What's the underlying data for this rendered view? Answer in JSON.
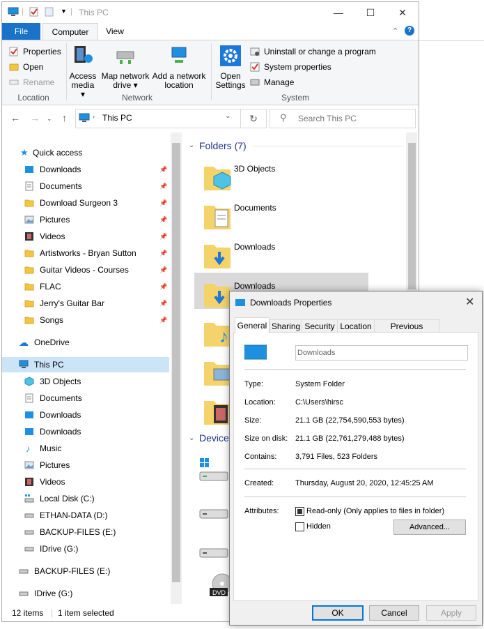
{
  "window": {
    "title": "This PC"
  },
  "ribbon": {
    "tabs": {
      "file": "File",
      "computer": "Computer",
      "view": "View"
    },
    "location": {
      "properties": "Properties",
      "open": "Open",
      "rename": "Rename",
      "group": "Location"
    },
    "network": {
      "access_media_1": "Access",
      "access_media_2": "media",
      "map_drive_1": "Map network",
      "map_drive_2": "drive",
      "add_location_1": "Add a network",
      "add_location_2": "location",
      "group": "Network"
    },
    "system": {
      "open_settings_1": "Open",
      "open_settings_2": "Settings",
      "uninstall": "Uninstall or change a program",
      "system_properties": "System properties",
      "manage": "Manage",
      "group": "System"
    }
  },
  "address": {
    "path": "This PC",
    "search_placeholder": "Search This PC"
  },
  "nav": {
    "quick_access": "Quick access",
    "quick_items": [
      "Downloads",
      "Documents",
      "Download Surgeon 3",
      "Pictures",
      "Videos",
      "Artistworks - Bryan Sutton",
      "Guitar Videos - Courses",
      "FLAC",
      "Jerry's Guitar Bar",
      "Songs"
    ],
    "onedrive": "OneDrive",
    "this_pc": "This PC",
    "pc_items": [
      "3D Objects",
      "Documents",
      "Downloads",
      "Downloads",
      "Music",
      "Pictures",
      "Videos",
      "Local Disk (C:)",
      "ETHAN-DATA (D:)",
      "BACKUP-FILES (E:)",
      "IDrive (G:)"
    ],
    "backup": "BACKUP-FILES (E:)",
    "idrive": "IDrive (G:)"
  },
  "content": {
    "folders_header": "Folders (7)",
    "folders": [
      "3D Objects",
      "Documents",
      "Downloads",
      "Downloads"
    ],
    "devices_header": "Device",
    "dvd_label": "DVD"
  },
  "status": {
    "items": "12 items",
    "selected": "1 item selected"
  },
  "dialog": {
    "title": "Downloads Properties",
    "tabs": [
      "General",
      "Sharing",
      "Security",
      "Location",
      "Previous Versions"
    ],
    "name_field": "Downloads",
    "rows": [
      {
        "label": "Type:",
        "value": "System Folder"
      },
      {
        "label": "Location:",
        "value": "C:\\Users\\hirsc"
      },
      {
        "label": "Size:",
        "value": "21.1 GB (22,754,590,553 bytes)"
      },
      {
        "label": "Size on disk:",
        "value": "21.1 GB (22,761,279,488 bytes)"
      },
      {
        "label": "Contains:",
        "value": "3,791 Files, 523 Folders"
      }
    ],
    "created_label": "Created:",
    "created_value": "Thursday, August 20, 2020, 12:45:25 AM",
    "attributes_label": "Attributes:",
    "readonly": "Read-only (Only applies to files in folder)",
    "hidden": "Hidden",
    "advanced": "Advanced...",
    "ok": "OK",
    "cancel": "Cancel",
    "apply": "Apply"
  }
}
